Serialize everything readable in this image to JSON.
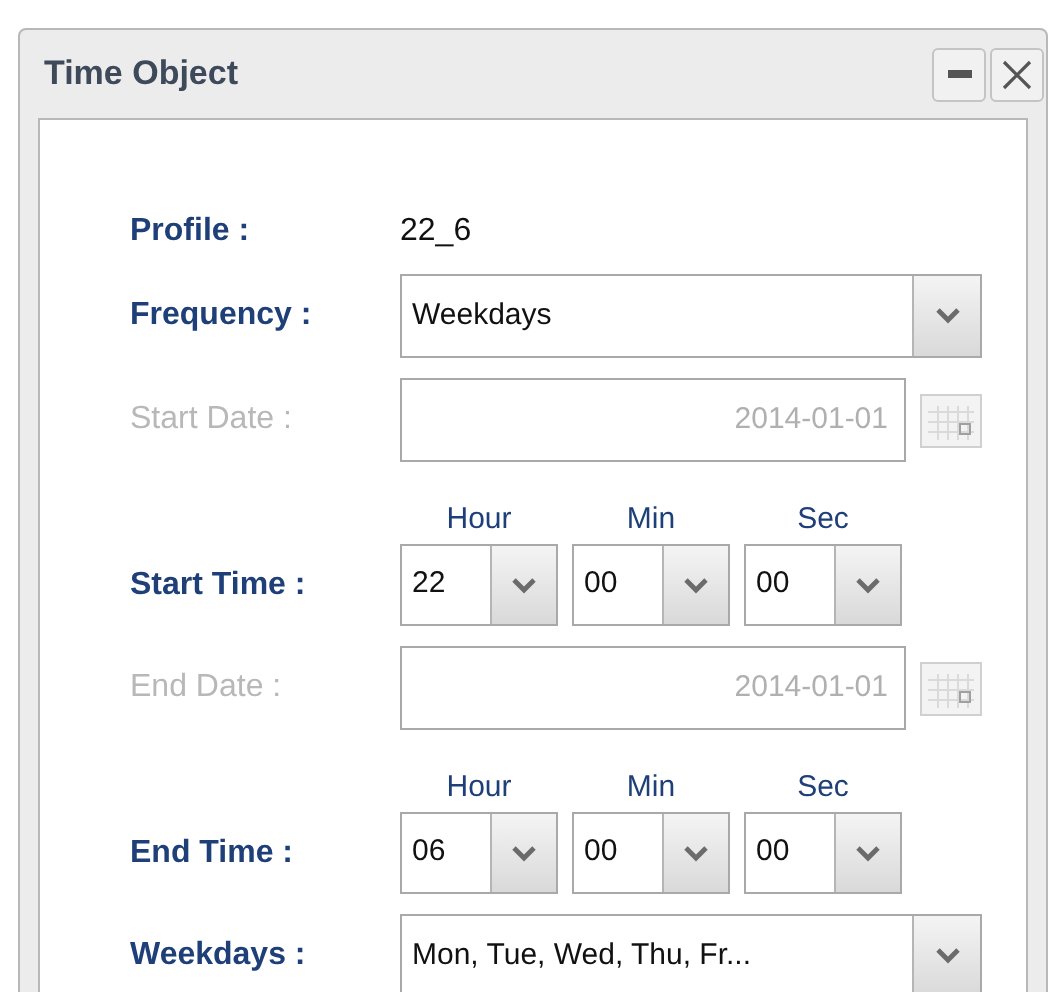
{
  "window": {
    "title": "Time Object",
    "buttons": [
      {
        "kind": "minimize"
      },
      {
        "kind": "close"
      }
    ]
  },
  "fields": [
    {
      "kind": "text",
      "label": "Profile :",
      "value": "22_6",
      "disabled": false
    },
    {
      "kind": "select",
      "label": "Frequency :",
      "value": "Weekdays",
      "disabled": false
    },
    {
      "kind": "date",
      "label": "Start Date :",
      "value": "2014-01-01",
      "disabled": true
    },
    {
      "kind": "time",
      "label": "Start Time :",
      "disabled": false,
      "parts": [
        {
          "label": "Hour",
          "value": "22"
        },
        {
          "label": "Min",
          "value": "00"
        },
        {
          "label": "Sec",
          "value": "00"
        }
      ]
    },
    {
      "kind": "date",
      "label": "End Date :",
      "value": "2014-01-01",
      "disabled": true
    },
    {
      "kind": "time",
      "label": "End Time :",
      "disabled": false,
      "parts": [
        {
          "label": "Hour",
          "value": "06"
        },
        {
          "label": "Min",
          "value": "00"
        },
        {
          "label": "Sec",
          "value": "00"
        }
      ]
    },
    {
      "kind": "select",
      "label": "Weekdays :",
      "value": "Mon, Tue, Wed, Thu, Fr...",
      "disabled": false
    }
  ]
}
